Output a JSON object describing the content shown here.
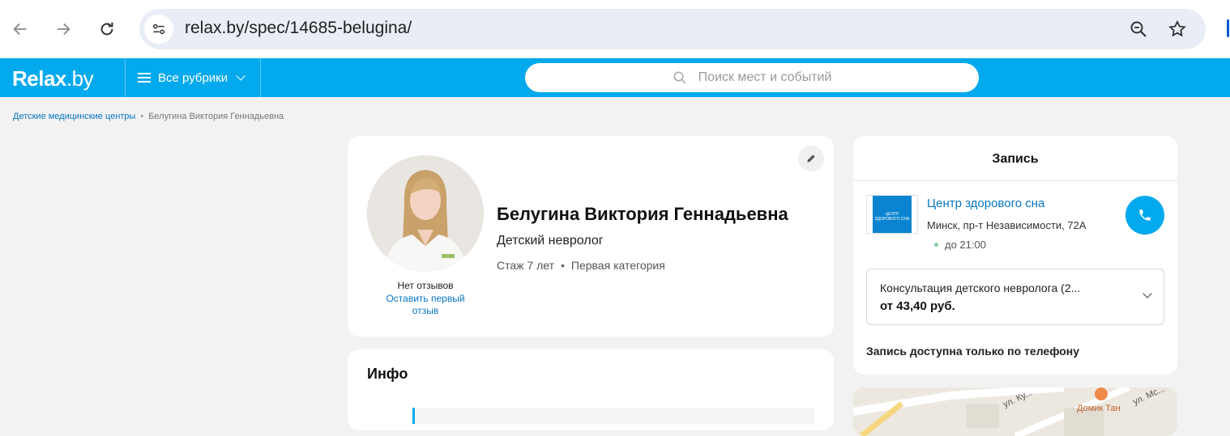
{
  "browser": {
    "url": "relax.by/spec/14685-belugina/"
  },
  "site": {
    "logo_main": "Relax",
    "logo_suffix": ".by",
    "rubrics_label": "Все рубрики",
    "search_placeholder": "Поиск мест и событий",
    "brand_color": "#03a9ed"
  },
  "breadcrumb": {
    "items": [
      "Детские медицинские центры",
      "Белугина Виктория Геннадьевна"
    ]
  },
  "profile": {
    "name": "Белугина Виктория Геннадьевна",
    "specialty": "Детский невролог",
    "experience": "Стаж 7 лет",
    "category": "Первая категория",
    "reviews_status": "Нет отзывов",
    "leave_review": "Оставить первый отзыв"
  },
  "info": {
    "title": "Инфо"
  },
  "booking": {
    "title": "Запись",
    "clinic_name": "Центр здорового сна",
    "clinic_logo_text": "центр здорового сна",
    "clinic_address": "Минск, пр-т Независимости, 72А",
    "clinic_hours": "до 21:00",
    "service_name": "Консультация детского невролога (2...",
    "service_price": "от 43,40 руб.",
    "phone_only_note": "Запись доступна только по телефону"
  },
  "map": {
    "labels": [
      "ул. Ку...",
      "ул. Мс...",
      "Домик Тан"
    ]
  }
}
